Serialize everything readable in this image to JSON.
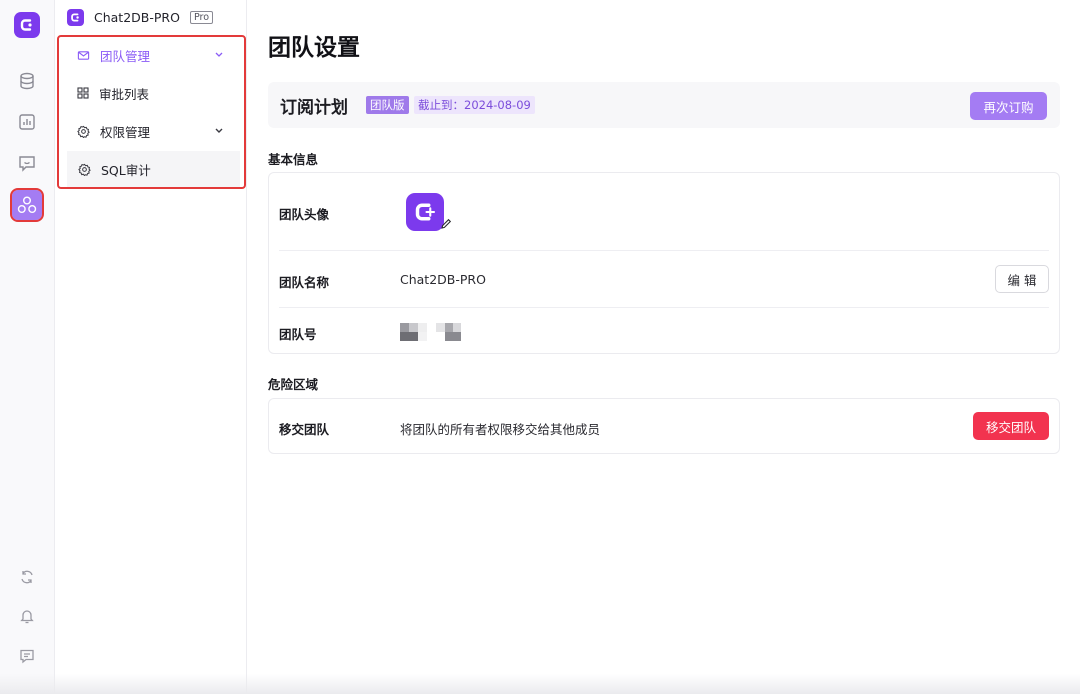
{
  "colors": {
    "accent": "#7c3aed",
    "accent_soft": "#a47cf3",
    "danger": "#f2334f",
    "highlight_box": "#e33a3a"
  },
  "rail": {
    "items": [
      {
        "name": "database-icon"
      },
      {
        "name": "chart-icon"
      },
      {
        "name": "chat-icon"
      },
      {
        "name": "team-icon",
        "active": true
      },
      {
        "name": "sync-icon"
      },
      {
        "name": "bell-icon"
      },
      {
        "name": "feedback-icon"
      }
    ]
  },
  "sidebar": {
    "brand": "Chat2DB-PRO",
    "brand_badge": "Pro",
    "items": [
      {
        "label": "团队管理",
        "icon": "mail-icon",
        "expanded": true
      },
      {
        "label": "审批列表",
        "icon": "grid-icon"
      },
      {
        "label": "权限管理",
        "icon": "gear-icon",
        "expanded": false
      },
      {
        "label": "SQL审计",
        "icon": "gear-icon",
        "selected": true
      }
    ]
  },
  "main": {
    "title": "团队设置",
    "subscription": {
      "title": "订阅计划",
      "badge": "团队版",
      "expire": "截止到：2024-08-09",
      "renew_button": "再次订购"
    },
    "basic": {
      "heading": "基本信息",
      "avatar_label": "团队头像",
      "name_label": "团队名称",
      "name_value": "Chat2DB-PRO",
      "edit_button": "编 辑",
      "id_label": "团队号"
    },
    "danger": {
      "heading": "危险区域",
      "transfer_label": "移交团队",
      "transfer_desc": "将团队的所有者权限移交给其他成员",
      "transfer_button": "移交团队"
    }
  }
}
